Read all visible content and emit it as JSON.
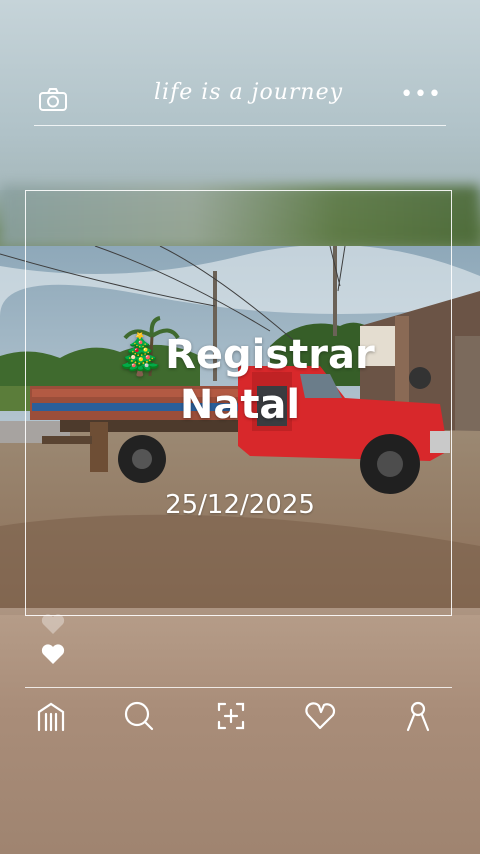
{
  "app": {
    "brand_text": "life is a journey"
  },
  "header": {
    "camera_icon": "camera-icon",
    "more_icon": "more-dots-icon",
    "more_label": "•••"
  },
  "post": {
    "title_emoji": "🎄",
    "title_line1": "Registrar",
    "title_line2": "Natal",
    "date": "25/12/2025",
    "likes": {
      "like_icon": "heart-icon"
    }
  },
  "nav": {
    "items": [
      {
        "name": "home",
        "icon": "home-icon"
      },
      {
        "name": "search",
        "icon": "search-icon"
      },
      {
        "name": "scan",
        "icon": "scan-add-icon"
      },
      {
        "name": "favorites",
        "icon": "heart-outline-icon"
      },
      {
        "name": "profile",
        "icon": "profile-icon"
      }
    ]
  },
  "colors": {
    "accent": "#ffffff",
    "truck": "#d8282b",
    "cargo_blue": "#2b5f9a"
  }
}
